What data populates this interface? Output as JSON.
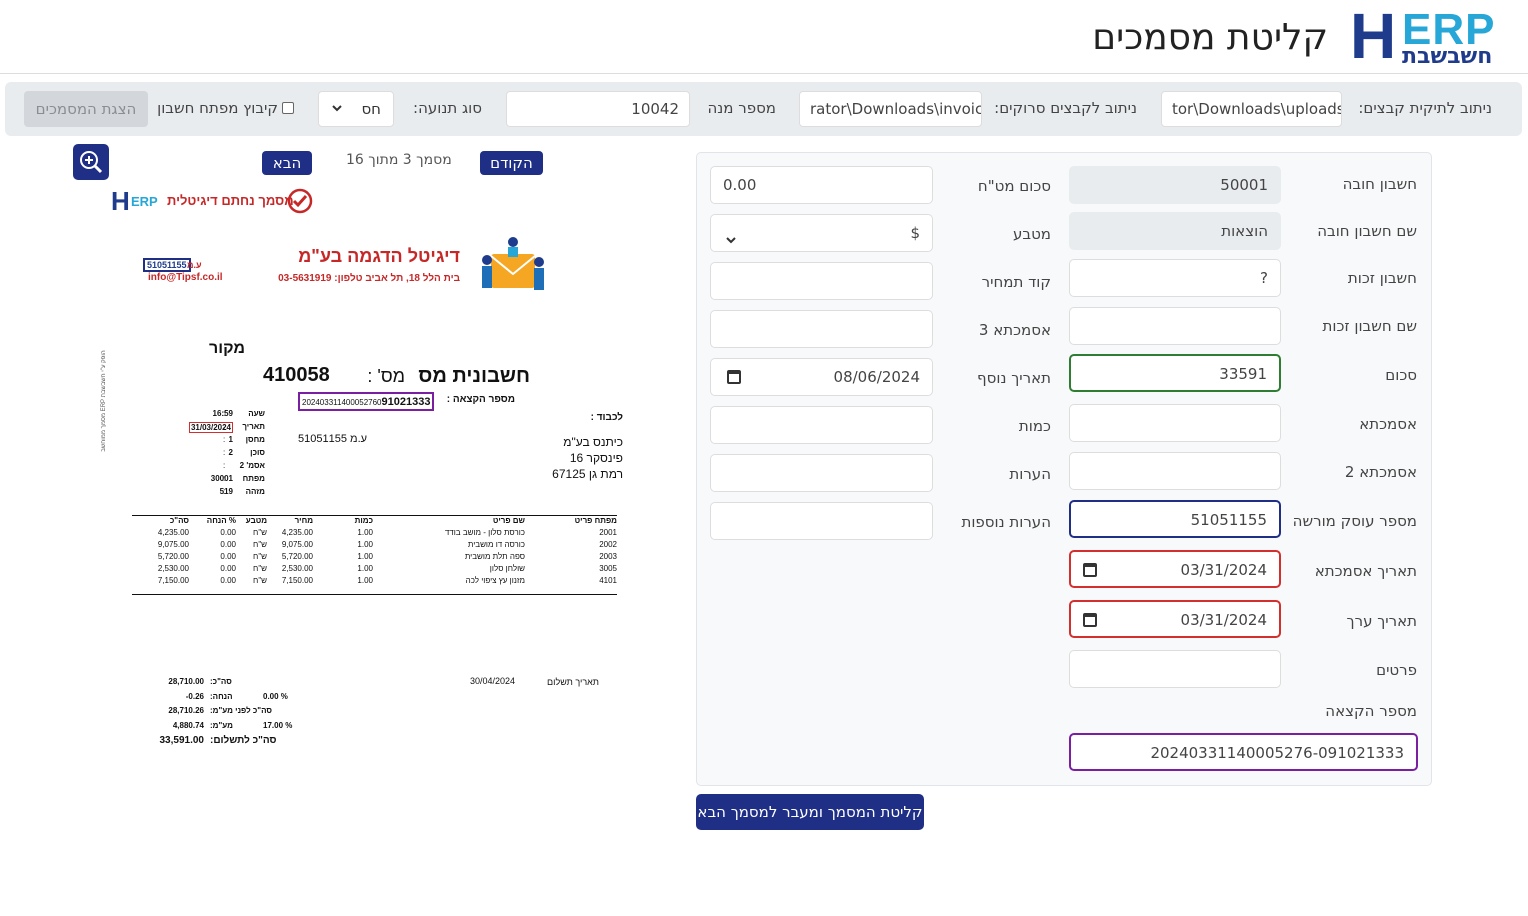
{
  "header": {
    "logo_letter": "H",
    "logo_erp": "ERP",
    "logo_heb": "חשבשבת",
    "title": "קליטת מסמכים"
  },
  "toolbar": {
    "folder_label": "ניתוב לתיקית קבצים:",
    "folder_value": "tor\\Downloads\\uploads",
    "scan_label": "ניתוב לקבצים סרוקים:",
    "scan_value": "rator\\Downloads\\invoic",
    "counter_label": "מספר מנה",
    "counter_value": "10042",
    "type_label": "סוג תנועה:",
    "type_value": "חס",
    "group_label": "קיבוץ מפתח חשבון",
    "show_button": "הצגת המסמכים"
  },
  "viewer": {
    "prev_label": "הקודם",
    "next_label": "הבא",
    "page_info": "מסמך 3 מתוך 16",
    "icons": {
      "zoom": "zoom-in-icon"
    }
  },
  "doc": {
    "stamp": "מסמך נחתם דיגיטלית",
    "stamp_erp": "ERP",
    "company": "דיגיטל הדגמה בע\"מ",
    "address": "בית הלל 18, תל אביב  טלפון: 03-5631919",
    "company_id_prefix": "ע.מ",
    "company_id": "51051155",
    "email": "info@Tipsf.co.il",
    "original": "מקור",
    "doc_title": "חשבונית מס",
    "doc_no_label": "מס' :",
    "doc_no": "410058",
    "alloc_label": "מספר הקצאה :",
    "alloc_prefix": "202403311400052760",
    "alloc_suffix": "91021333",
    "side_note": "הופק ע\"י חשבשבת ERP מסמך ממוחשב",
    "to_label": "לכבוד :",
    "client_name": "כיתנס בע\"מ",
    "client_street": "פינסקר 16",
    "client_city": "רמת גן  67125",
    "client_id": "ע.מ 51051155",
    "meta": [
      {
        "k": "שעה",
        "v": "16:59"
      },
      {
        "k": "תאריך",
        "v": "31/03/2024"
      },
      {
        "k": "מחסן",
        "v": "1"
      },
      {
        "k": "סוכן",
        "v": "2"
      },
      {
        "k": "אסמ' 2",
        "v": ""
      },
      {
        "k": "מפתח",
        "v": "30001"
      },
      {
        "k": "מזהה",
        "v": "519"
      }
    ],
    "cols": [
      "מפתח פריט",
      "שם פריט",
      "כמות",
      "מחיר",
      "מטבע",
      "% הנחה",
      "סה\"כ"
    ],
    "rows": [
      [
        "2001",
        "כורסת סלון - מושב בודד",
        "1.00",
        "4,235.00",
        "ש\"ח",
        "0.00",
        "4,235.00"
      ],
      [
        "2002",
        "כורסה דו מושבית",
        "1.00",
        "9,075.00",
        "ש\"ח",
        "0.00",
        "9,075.00"
      ],
      [
        "2003",
        "ספה תלת מושבית",
        "1.00",
        "5,720.00",
        "ש\"ח",
        "0.00",
        "5,720.00"
      ],
      [
        "3005",
        "שולחן סלון",
        "1.00",
        "2,530.00",
        "ש\"ח",
        "0.00",
        "2,530.00"
      ],
      [
        "4101",
        "מזנון עץ ציפוי לכה",
        "1.00",
        "7,150.00",
        "ש\"ח",
        "0.00",
        "7,150.00"
      ]
    ],
    "pay_date_label": "תאריך תשלום",
    "pay_date": "30/04/2024",
    "totals": [
      {
        "k": "סה\"כ:",
        "p": "",
        "v": "28,710.00"
      },
      {
        "k": "הנחה:",
        "p": "0.00  %",
        "v": "-0.26"
      },
      {
        "k": "סה\"כ לפני מע\"מ:",
        "p": "",
        "v": "28,710.26"
      },
      {
        "k": "מע\"מ:",
        "p": "17.00  %",
        "v": "4,880.74"
      },
      {
        "k": "סה\"כ לתשלום:",
        "p": "",
        "v": "33,591.00"
      }
    ]
  },
  "form": {
    "debit_label": "חשבון חובה",
    "debit": "50001",
    "debit_name_label": "שם חשבון חובה",
    "debit_name": "הוצאות",
    "credit_label": "חשבון זכות",
    "credit": "?",
    "credit_name_label": "שם חשבון זכות",
    "credit_name": "",
    "amount_label": "סכום",
    "amount": "33591",
    "ref_label": "אסמכתא",
    "ref": "",
    "ref2_label": "אסמכתא 2",
    "ref2": "",
    "dealer_label": "מספר עוסק מורשה",
    "dealer": "51051155",
    "ref_date_label": "תאריך אסמכתא",
    "ref_date": "03/31/2024",
    "value_date_label": "תאריך ערך",
    "value_date": "03/31/2024",
    "details_label": "פרטים",
    "details": "",
    "alloc_label": "מספר הקצאה",
    "alloc": "20240331140005276-091021333",
    "fx_amount_label": "סכום מט\"ח",
    "fx_amount": "0.00",
    "currency_label": "מטבע",
    "currency": "$",
    "cost_label": "קוד תמחיר",
    "cost": "",
    "ref3_label": "אסמכתא 3",
    "ref3": "",
    "extra_date_label": "תאריך נוסף",
    "extra_date": "08/06/2024",
    "qty_label": "כמות",
    "qty": "",
    "notes_label": "הערות",
    "notes": "",
    "extra_notes_label": "הערות נוספות",
    "extra_notes": ""
  },
  "submit_label": "קליטת המסמך ומעבר למסמך הבא"
}
